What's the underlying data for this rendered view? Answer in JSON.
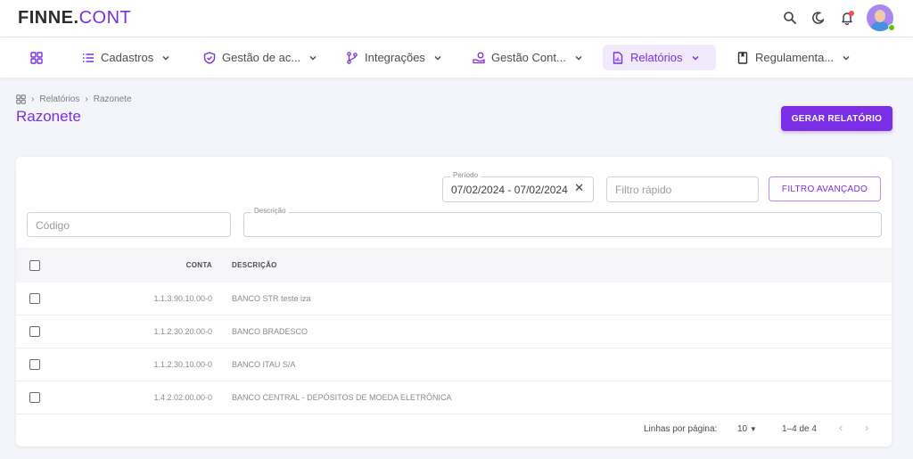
{
  "app": {
    "logo_bold": "FINNE.",
    "logo_light": "CONT"
  },
  "topbar": {
    "icons": [
      "search-icon",
      "moon-icon",
      "bell-icon",
      "avatar"
    ]
  },
  "nav": {
    "items": [
      {
        "label": "",
        "icon": "grid-icon"
      },
      {
        "label": "Cadastros",
        "icon": "list-icon"
      },
      {
        "label": "Gestão de ac...",
        "icon": "shield-icon"
      },
      {
        "label": "Integrações",
        "icon": "branch-icon"
      },
      {
        "label": "Gestão Cont...",
        "icon": "money-icon"
      },
      {
        "label": "Relatórios",
        "icon": "report-icon",
        "active": true
      },
      {
        "label": "Regulamenta...",
        "icon": "book-icon"
      }
    ]
  },
  "breadcrumb": {
    "items": [
      "Relatórios",
      "Razonete"
    ]
  },
  "page": {
    "title": "Razonete",
    "generate_button": "GERAR RELATÓRIO"
  },
  "filters": {
    "period_label": "Período",
    "period_value": "07/02/2024 - 07/02/2024",
    "quick_filter_placeholder": "Filtro rápido",
    "advanced_button": "FILTRO AVANÇADO",
    "code_placeholder": "Código",
    "description_label": "Descrição"
  },
  "table": {
    "headers": {
      "conta": "CONTA",
      "descricao": "DESCRIÇÃO"
    },
    "rows": [
      {
        "conta": "1.1.3.90.10.00-0",
        "descricao": "BANCO STR teste iza"
      },
      {
        "conta": "1.1.2.30.20.00-0",
        "descricao": "BANCO BRADESCO"
      },
      {
        "conta": "1.1.2.30.10.00-0",
        "descricao": "BANCO ITAU S/A"
      },
      {
        "conta": "1.4.2.02.00.00-0",
        "descricao": "BANCO CENTRAL - DEPÓSITOS DE MOEDA ELETRÔNICA"
      }
    ]
  },
  "pagination": {
    "rows_per_page_label": "Linhas por página:",
    "rows_per_page": "10",
    "range": "1–4 de 4"
  },
  "colors": {
    "accent": "#7a2ee6",
    "background": "#f4f5fa"
  }
}
